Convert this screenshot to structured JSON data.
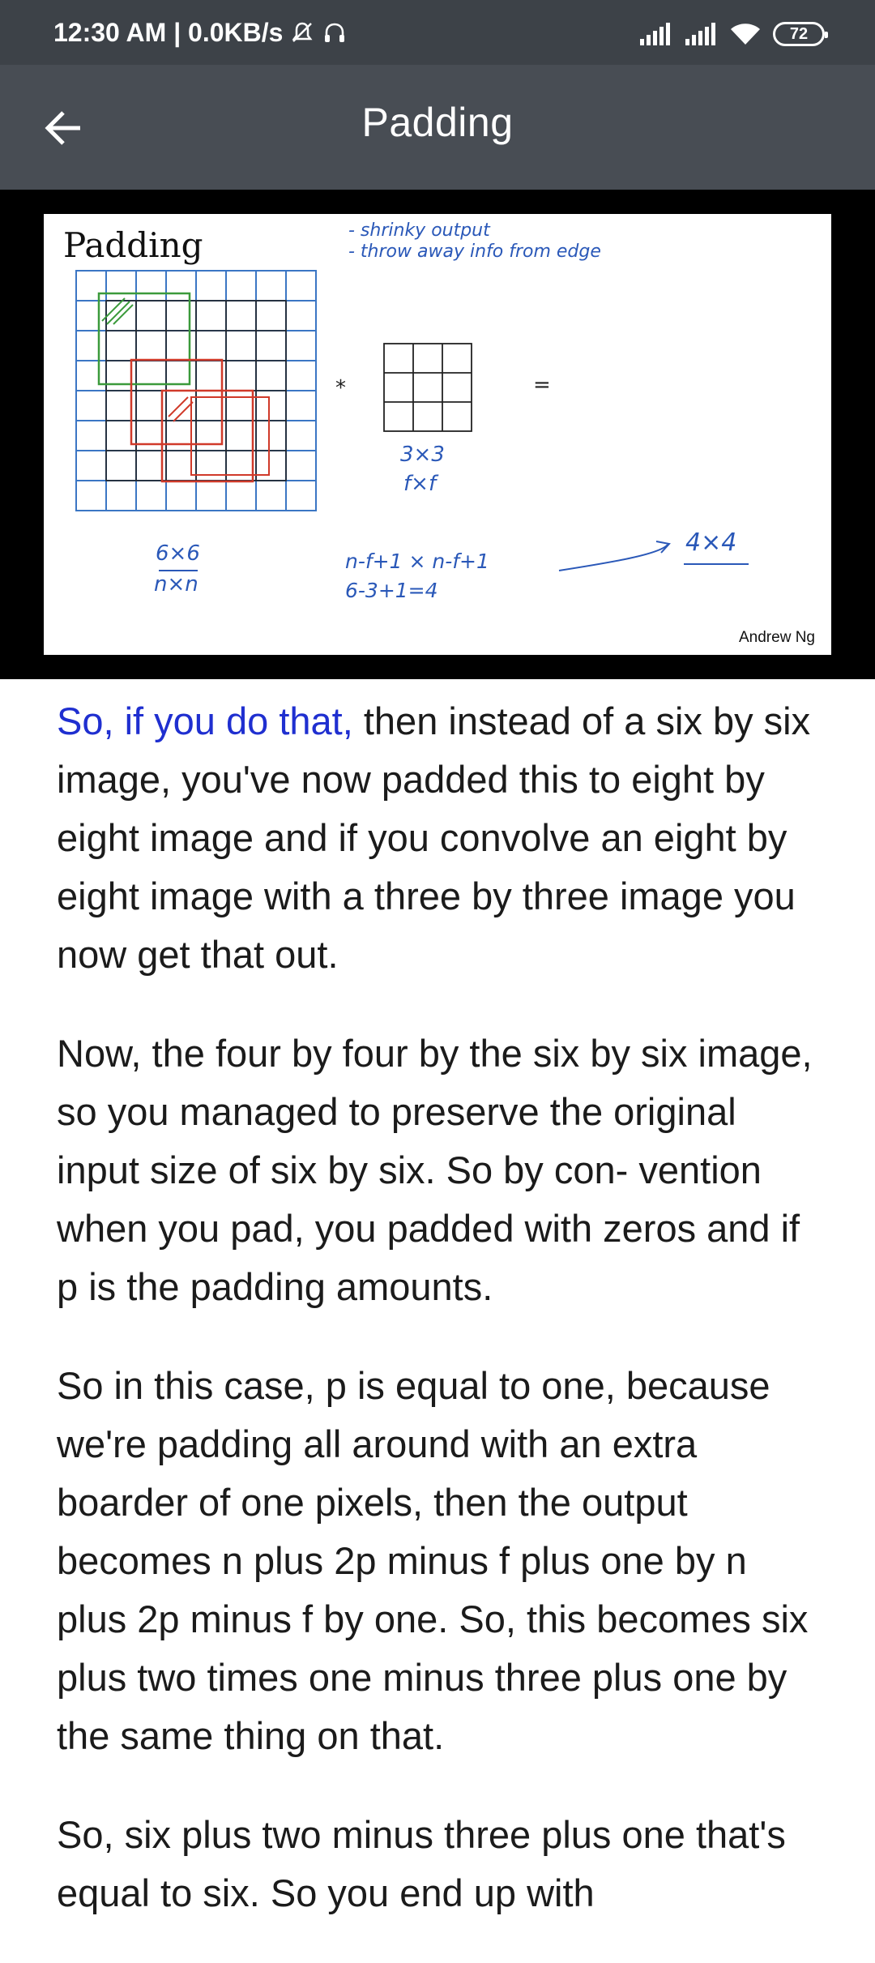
{
  "status_bar": {
    "time_net": "12:30 AM | 0.0KB/s",
    "battery": "72"
  },
  "app_bar": {
    "title": "Padding"
  },
  "slide": {
    "title": "Padding",
    "note_line1": "- shrinky output",
    "note_line2": "- throw away info from edge",
    "filter_size": "3×3",
    "filter_dims": "f×f",
    "input_size": "6×6",
    "input_dims": "n×n",
    "formula": "n-f+1  ×  n-f+1",
    "calc": "6-3+1=4",
    "result": "4×4",
    "conv_symbol": "*",
    "equals_symbol": "=",
    "credit": "Andrew Ng"
  },
  "transcript": {
    "p1_highlight": "So, if you do that,",
    "p1_rest": " then instead of a six by six image, you've now padded this to eight by eight image and if you convolve an eight by eight image with a three by three image you now get that out.",
    "p2": "Now, the four by four by the six by six image, so you managed to preserve the original input size of six by six. So by con- vention when you pad, you padded with zeros and if p is the padding amounts.",
    "p3": "So in this case, p is equal to one, because we're padding all around with an extra boarder of one pixels, then the output becomes n plus 2p minus f plus one by n plus 2p minus f by one. So, this becomes six plus two times one minus three plus one by the same thing on that.",
    "p4": "So, six plus two minus three plus one that's equal to six. So you end up with"
  },
  "colors": {
    "status_bar_bg": "#3d4248",
    "app_bar_bg": "#484d54",
    "highlight_text": "#1f2fd0",
    "body_text": "#1b1b1b"
  },
  "icons": [
    "mute-icon",
    "headset-icon",
    "signal-icon",
    "wifi-icon",
    "battery-icon",
    "back-arrow-icon"
  ]
}
